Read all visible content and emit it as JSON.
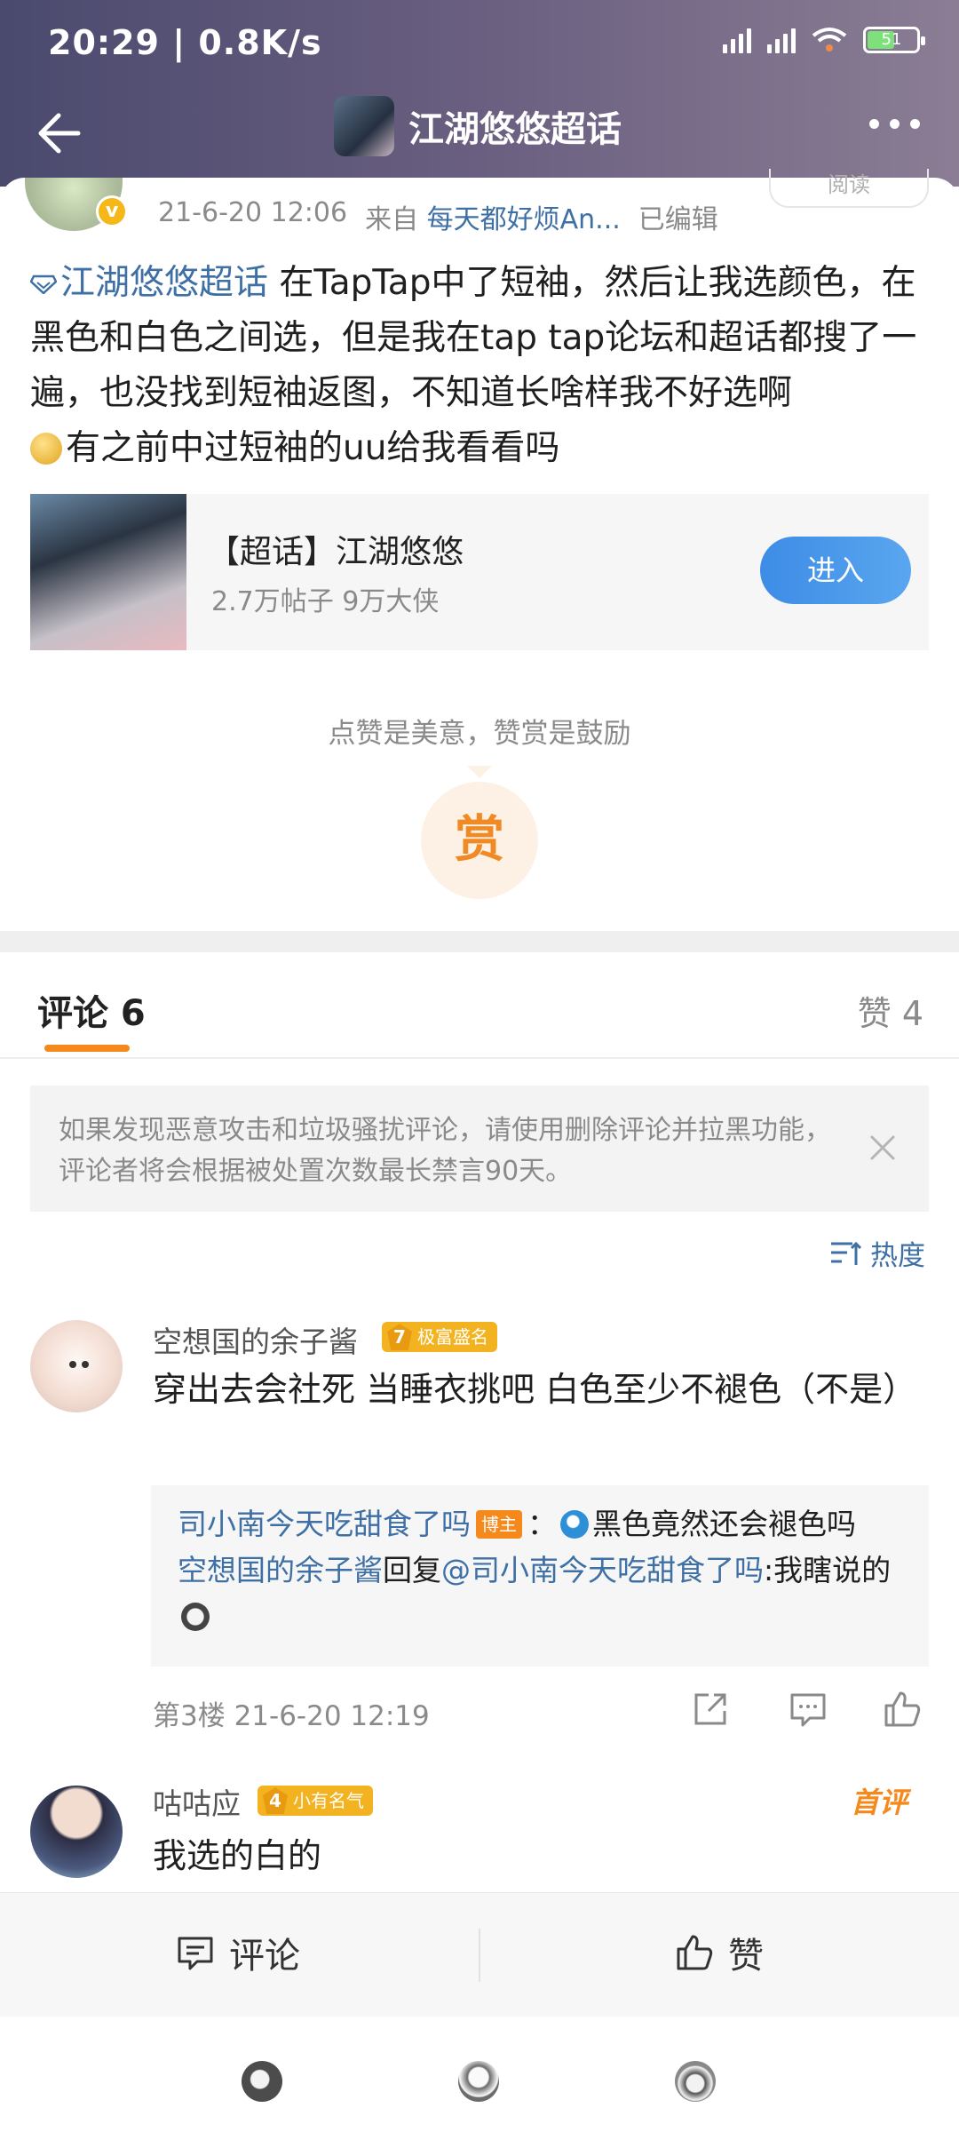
{
  "status_bar": {
    "time": "20:29",
    "speed": "0.8K/s",
    "battery": "51"
  },
  "nav": {
    "title": "江湖悠悠超话",
    "back_icon": "arrow-left-icon",
    "more_icon": "more-dots-icon"
  },
  "post": {
    "date": "21-6-20 12:06",
    "source_prefix": "来自",
    "source": "每天都好烦An...",
    "edited": "已编辑",
    "read_label": "阅读",
    "topic_link": "江湖悠悠超话",
    "body_1": " 在TapTap中了短袖，然后让我选颜色，在黑色和白色之间选，但是我在tap tap论坛和超话都搜了一遍，也没找到短袖返图，不知道长啥样我不好选啊",
    "body_2": "有之前中过短袖的uu给我看看吗"
  },
  "topic_card": {
    "name": "【超话】江湖悠悠",
    "stats": "2.7万帖子 9万大侠",
    "enter": "进入"
  },
  "reward": {
    "tip": "点赞是美意，赞赏是鼓励",
    "label": "赏"
  },
  "tabs": {
    "comments": "评论 6",
    "likes": "赞 4"
  },
  "notice": {
    "text": "如果发现恶意攻击和垃圾骚扰评论，请使用删除评论并拉黑功能，评论者将会根据被处置次数最长禁言90天。"
  },
  "sort": {
    "label": "热度"
  },
  "comments": [
    {
      "name": "空想国的余子酱",
      "level": "7",
      "level_label": "极富盛名",
      "text": "穿出去会社死 当睡衣挑吧 白色至少不褪色（不是）",
      "replies": [
        {
          "user": "司小南今天吃甜食了吗",
          "tag": "博主",
          "sep": "：",
          "text": "黑色竟然还会褪色吗"
        },
        {
          "user": "空想国的余子酱",
          "mid": "回复",
          "target": "@司小南今天吃甜食了吗",
          "text": ":我瞎说的"
        }
      ],
      "footer": "第3楼 21-6-20 12:19"
    },
    {
      "name": "咕咕应",
      "level": "4",
      "level_label": "小有名气",
      "badge": "首评",
      "text": "我选的白的"
    }
  ],
  "action_bar": {
    "comment": "评论",
    "like": "赞"
  },
  "colors": {
    "link": "#3e6fa5",
    "accent": "#f5891b",
    "enter_button": "#3d8ce6",
    "level_badge": "#f3b320"
  }
}
